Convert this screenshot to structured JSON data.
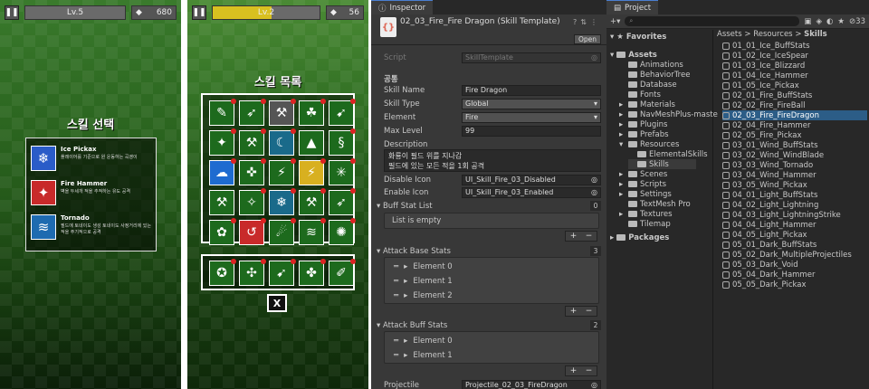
{
  "game1": {
    "level": "Lv.5",
    "gems": "680",
    "title": "스킬 선택",
    "options": [
      {
        "name": "Ice Pickax",
        "desc": "플레이어를 기준으로 원 운동하는 곡괭이",
        "icon": "ice-pickax-icon",
        "color": "#2a5cc8",
        "glyph": "❄"
      },
      {
        "name": "Fire Hammer",
        "desc": "벽을 두세개 적을 추적하는 유도 공격",
        "icon": "fire-hammer-icon",
        "color": "#c82a2a",
        "glyph": "✦"
      },
      {
        "name": "Tornado",
        "desc": "필드에 토네이도 생성 토네이도 사정거리에 있는 적을 주기적으로 공격",
        "icon": "tornado-icon",
        "color": "#1e6bb0",
        "glyph": "≋"
      }
    ]
  },
  "game2": {
    "level": "Lv.2",
    "gems": "56",
    "title": "스킬 목록",
    "close": "X",
    "cells": [
      {
        "g": "✎",
        "red": 1
      },
      {
        "g": "➶",
        "red": 1
      },
      {
        "g": "⚒",
        "red": 1,
        "bg": "#555"
      },
      {
        "g": "☘",
        "red": 1
      },
      {
        "g": "➹",
        "red": 1
      },
      {
        "g": "✦",
        "red": 1
      },
      {
        "g": "⚒",
        "red": 1
      },
      {
        "g": "☾",
        "red": 1,
        "bg": "#1a6a8a"
      },
      {
        "g": "▲",
        "red": 0
      },
      {
        "g": "§",
        "red": 1
      },
      {
        "g": "☁",
        "red": 1,
        "bg": "#1e6bd0"
      },
      {
        "g": "✜",
        "red": 1
      },
      {
        "g": "⚡",
        "red": 1
      },
      {
        "g": "⚡",
        "red": 1,
        "bg": "#d8b020"
      },
      {
        "g": "✳",
        "red": 1
      },
      {
        "g": "⚒",
        "red": 0
      },
      {
        "g": "✧",
        "red": 1
      },
      {
        "g": "❄",
        "red": 1,
        "bg": "#1a6a8a"
      },
      {
        "g": "⚒",
        "red": 1
      },
      {
        "g": "➶",
        "red": 1
      },
      {
        "g": "✿",
        "red": 1
      },
      {
        "g": "↺",
        "red": 1,
        "bg": "#c82a2a"
      },
      {
        "g": "☄",
        "red": 1
      },
      {
        "g": "≋",
        "red": 1
      },
      {
        "g": "✺",
        "red": 1
      }
    ],
    "cells2": [
      {
        "g": "✪",
        "red": 1
      },
      {
        "g": "✣",
        "red": 1
      },
      {
        "g": "➹",
        "red": 1
      },
      {
        "g": "✤",
        "red": 1
      },
      {
        "g": "✐",
        "red": 1
      }
    ]
  },
  "inspector": {
    "tab": "Inspector",
    "title": "02_03_Fire_Fire Dragon (Skill Template)",
    "open": "Open",
    "script_label": "Script",
    "script_value": "SkillTemplate",
    "section": "공통",
    "fields": [
      {
        "label": "Skill Name",
        "value": "Fire Dragon",
        "type": "text"
      },
      {
        "label": "Skill Type",
        "value": "Global",
        "type": "drop"
      },
      {
        "label": "Element",
        "value": "Fire",
        "type": "drop"
      },
      {
        "label": "Max Level",
        "value": "99",
        "type": "text"
      }
    ],
    "desc_label": "Description",
    "desc_line1": "화룡이 필드 위를 지나감",
    "desc_line2": "필드에 있는 모든 적을 1회 공격",
    "disable_label": "Disable Icon",
    "disable_value": "UI_Skill_Fire_03_Disabled",
    "enable_label": "Enable Icon",
    "enable_value": "UI_Skill_Fire_03_Enabled",
    "buff_list": "Buff Stat List",
    "buff_count": "0",
    "empty": "List is empty",
    "attack_base": "Attack Base Stats",
    "attack_base_count": "3",
    "attack_base_elems": [
      "Element 0",
      "Element 1",
      "Element 2"
    ],
    "attack_buff": "Attack Buff Stats",
    "attack_buff_count": "2",
    "attack_buff_elems": [
      "Element 0",
      "Element 1"
    ],
    "projectile_label": "Projectile",
    "projectile_value": "Projectile_02_03_FireDragon"
  },
  "project": {
    "tab": "Project",
    "badge": "33",
    "favorites": "Favorites",
    "assets": "Assets",
    "tree": [
      "Animations",
      "BehaviorTree",
      "Database",
      "Fonts",
      "Materials",
      "NavMeshPlus-maste",
      "Plugins",
      "Prefabs",
      "Resources",
      "ElementalSkills",
      "Skills",
      "Scenes",
      "Scripts",
      "Settings",
      "TextMesh Pro",
      "Textures",
      "Tilemap"
    ],
    "packages": "Packages",
    "crumb1": "Assets",
    "crumb2": "Resources",
    "crumb3": "Skills",
    "files": [
      "01_01_Ice_BuffStats",
      "01_02_Ice_IceSpear",
      "01_03_Ice_Blizzard",
      "01_04_Ice_Hammer",
      "01_05_Ice_Pickax",
      "02_01_Fire_BuffStats",
      "02_02_Fire_FireBall",
      "02_03_Fire_FireDragon",
      "02_04_Fire_Hammer",
      "02_05_Fire_Pickax",
      "03_01_Wind_BuffStats",
      "03_02_Wind_WindBlade",
      "03_03_Wind_Tornado",
      "03_04_Wind_Hammer",
      "03_05_Wind_Pickax",
      "04_01_Light_BuffStats",
      "04_02_Light_Lightning",
      "04_03_Light_LightningStrike",
      "04_04_Light_Hammer",
      "04_05_Light_Pickax",
      "05_01_Dark_BuffStats",
      "05_02_Dark_MultipleProjectiles",
      "05_03_Dark_Void",
      "05_04_Dark_Hammer",
      "05_05_Dark_Pickax"
    ],
    "selected_index": 7
  }
}
